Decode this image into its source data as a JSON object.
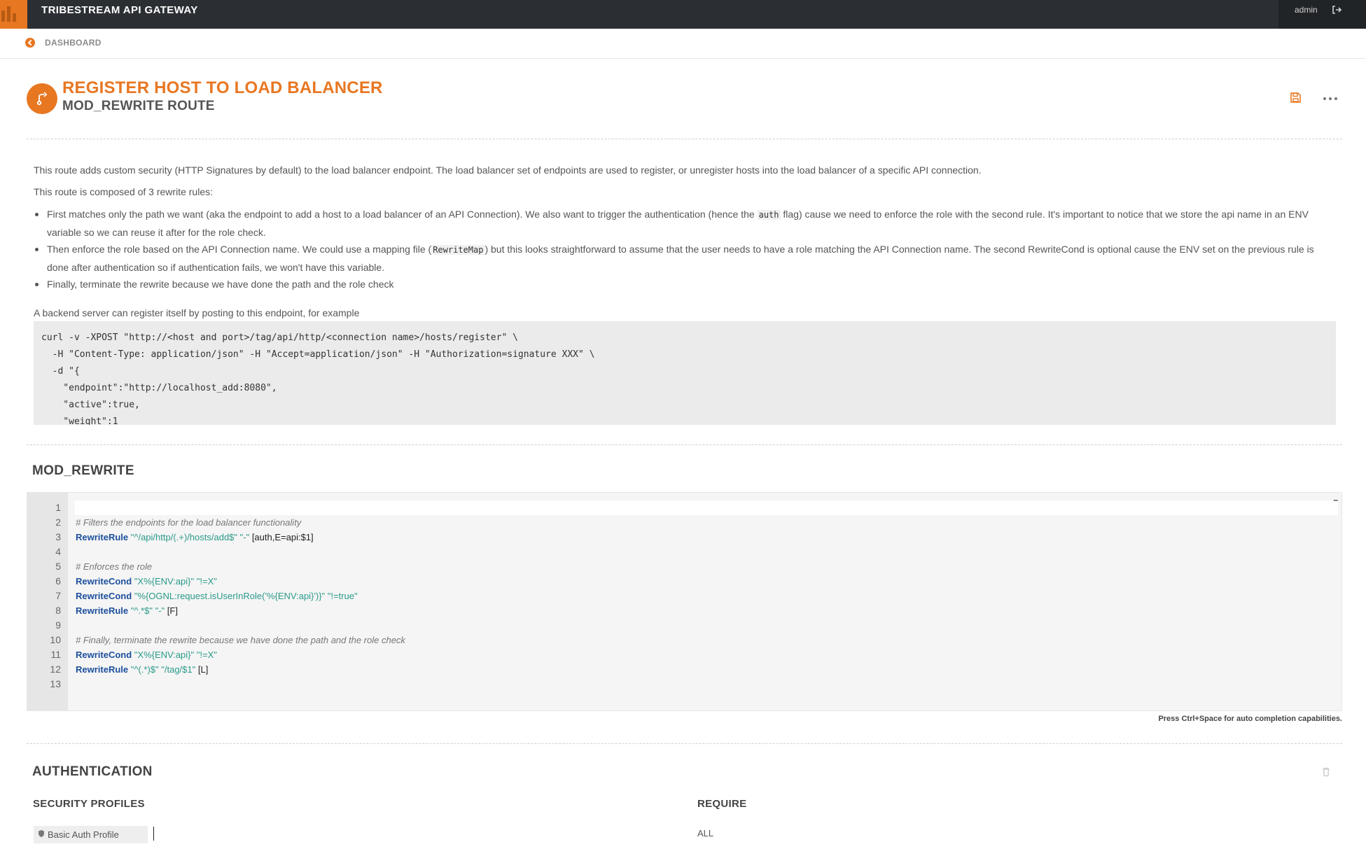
{
  "app": {
    "title": "TRIBESTREAM API GATEWAY",
    "user": "admin"
  },
  "breadcrumb": {
    "label": "DASHBOARD"
  },
  "header": {
    "title": "REGISTER HOST TO LOAD BALANCER",
    "subtitle": "MOD_REWRITE ROUTE"
  },
  "description": {
    "intro": "This route adds custom security (HTTP Signatures by default) to the load balancer endpoint. The load balancer set of endpoints are used to register, or unregister hosts into the load balancer of a specific API connection.",
    "composed": "This route is composed of 3 rewrite rules:",
    "bullet1_a": "First matches only the path we want (aka the endpoint to add a host to a load balancer of an API Connection). We also want to trigger the authentication (hence the ",
    "bullet1_code": "auth",
    "bullet1_b": " flag) cause we need to enforce the role with the second rule. It's important to notice that we store the api name in an ENV variable so we can reuse it after for the role check.",
    "bullet2_a": "Then enforce the role based on the API Connection name. We could use a mapping file (",
    "bullet2_code": "RewriteMap",
    "bullet2_b": ") but this looks straightforward to assume that the user needs to have a role matching the API Connection name. The second RewriteCond is optional cause the ENV set on the previous rule is done after authentication so if authentication fails, we won't have this variable.",
    "bullet3": "Finally, terminate the rewrite because we have done the path and the role check",
    "example_intro": "A backend server can register itself by posting to this endpoint, for example",
    "example_code": "curl -v -XPOST \"http://<host and port>/tag/api/http/<connection name>/hosts/register\" \\\n  -H \"Content-Type: application/json\" -H \"Accept=application/json\" -H \"Authorization=signature XXX\" \\\n  -d \"{\n    \"endpoint\":\"http://localhost_add:8080\",\n    \"active\":true,\n    \"weight\":1"
  },
  "mod_rewrite": {
    "section_title": "MOD_REWRITE",
    "line_numbers": [
      "1",
      "2",
      "3",
      "4",
      "5",
      "6",
      "7",
      "8",
      "9",
      "10",
      "11",
      "12",
      "13"
    ],
    "lines": {
      "l2_comment": "# Filters the endpoints for the load balancer functionality",
      "l3_kw": "RewriteRule",
      "l3_str": " \"^/api/http/(.+)/hosts/add$\" \"-\"",
      "l3_plain": " [auth,E=api:$1]",
      "l5_comment": "# Enforces the role",
      "l6_kw": "RewriteCond",
      "l6_str": " \"X%{ENV:api}\" \"!=X\"",
      "l7_kw": "RewriteCond",
      "l7_str": " \"%{OGNL:request.isUserInRole('%{ENV:api}')}\" \"!=true\"",
      "l8_kw": "RewriteRule",
      "l8_str": " \"^.*$\" \"-\"",
      "l8_plain": " [F]",
      "l10_comment": "# Finally, terminate the rewrite because we have done the path and the role check",
      "l11_kw": "RewriteCond",
      "l11_str": " \"X%{ENV:api}\" \"!=X\"",
      "l12_kw": "RewriteRule",
      "l12_str": " \"^(.*)$\" \"/tag/$1\"",
      "l12_plain": " [L]"
    },
    "collapse_symbol": "–",
    "hint": "Press Ctrl+Space for auto completion capabilities."
  },
  "authentication": {
    "section_title": "AUTHENTICATION",
    "profiles_header": "SECURITY PROFILES",
    "require_header": "REQUIRE",
    "profiles": [
      "Basic Auth Profile"
    ],
    "require_value": "ALL"
  },
  "colors": {
    "accent": "#e87722",
    "topbar": "#2b2f33",
    "keyword": "#1c4f9c",
    "string": "#2a9a8a"
  },
  "icons": [
    "logo-icon",
    "logout-icon",
    "back-icon",
    "route-fork-icon",
    "save-icon",
    "more-icon",
    "trash-icon",
    "shield-icon"
  ]
}
